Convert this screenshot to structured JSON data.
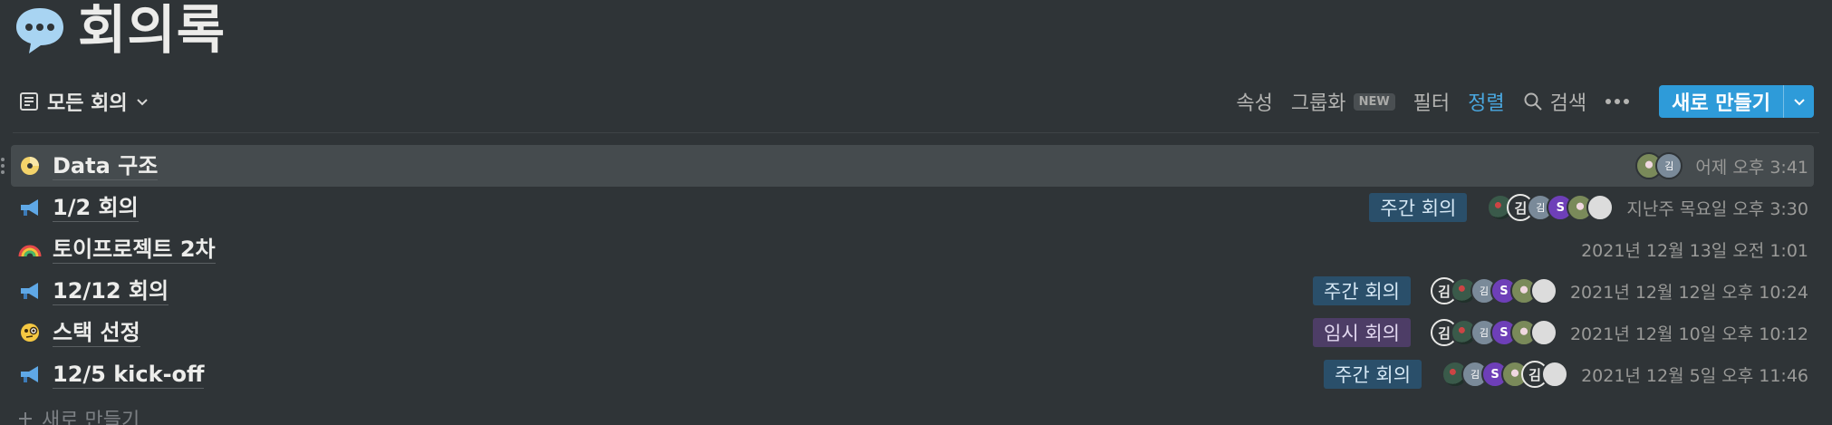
{
  "page": {
    "title": "회의록",
    "icon": "speech-bubble-icon"
  },
  "toolbar": {
    "view_label": "모든 회의",
    "tools": {
      "properties": "속성",
      "group": "그룹화",
      "group_badge": "NEW",
      "filter": "필터",
      "sort": "정렬",
      "search": "검색"
    },
    "new_button": "새로 만들기",
    "accent": "#2e9bd9"
  },
  "rows": [
    {
      "icon": "dvd-icon",
      "title": "Data 구조",
      "tag": "",
      "avatars": [
        "flower",
        "gray"
      ],
      "date": "어제 오후 3:41"
    },
    {
      "icon": "megaphone-icon",
      "title": "1/2 회의",
      "tag": "주간 회의",
      "tag_color": "blue",
      "avatars": [
        "photo",
        "kim",
        "gray",
        "s",
        "flower",
        "moon"
      ],
      "date": "지난주 목요일 오후 3:30"
    },
    {
      "icon": "rainbow-icon",
      "title": "토이프로젝트 2차",
      "tag": "",
      "avatars": [],
      "date": "2021년 12월 13일 오전 1:01"
    },
    {
      "icon": "megaphone-icon",
      "title": "12/12 회의",
      "tag": "주간 회의",
      "tag_color": "blue",
      "avatars": [
        "kim",
        "photo",
        "gray",
        "s",
        "flower",
        "moon"
      ],
      "date": "2021년 12월 12일 오후 10:24"
    },
    {
      "icon": "monocle-face-icon",
      "title": "스택 선정",
      "tag": "임시 회의",
      "tag_color": "purple",
      "avatars": [
        "kim",
        "photo",
        "gray",
        "s",
        "flower",
        "moon"
      ],
      "date": "2021년 12월 10일 오후 10:12"
    },
    {
      "icon": "megaphone-icon",
      "title": "12/5 kick-off",
      "tag": "주간 회의",
      "tag_color": "blue",
      "avatars": [
        "photo",
        "gray",
        "s",
        "flower",
        "kim",
        "moon"
      ],
      "date": "2021년 12월 5일 오후 11:46"
    }
  ],
  "avatar_labels": {
    "kim": "김",
    "gray": "김",
    "s": "S"
  },
  "footer": {
    "new_label": "새로 만들기"
  }
}
